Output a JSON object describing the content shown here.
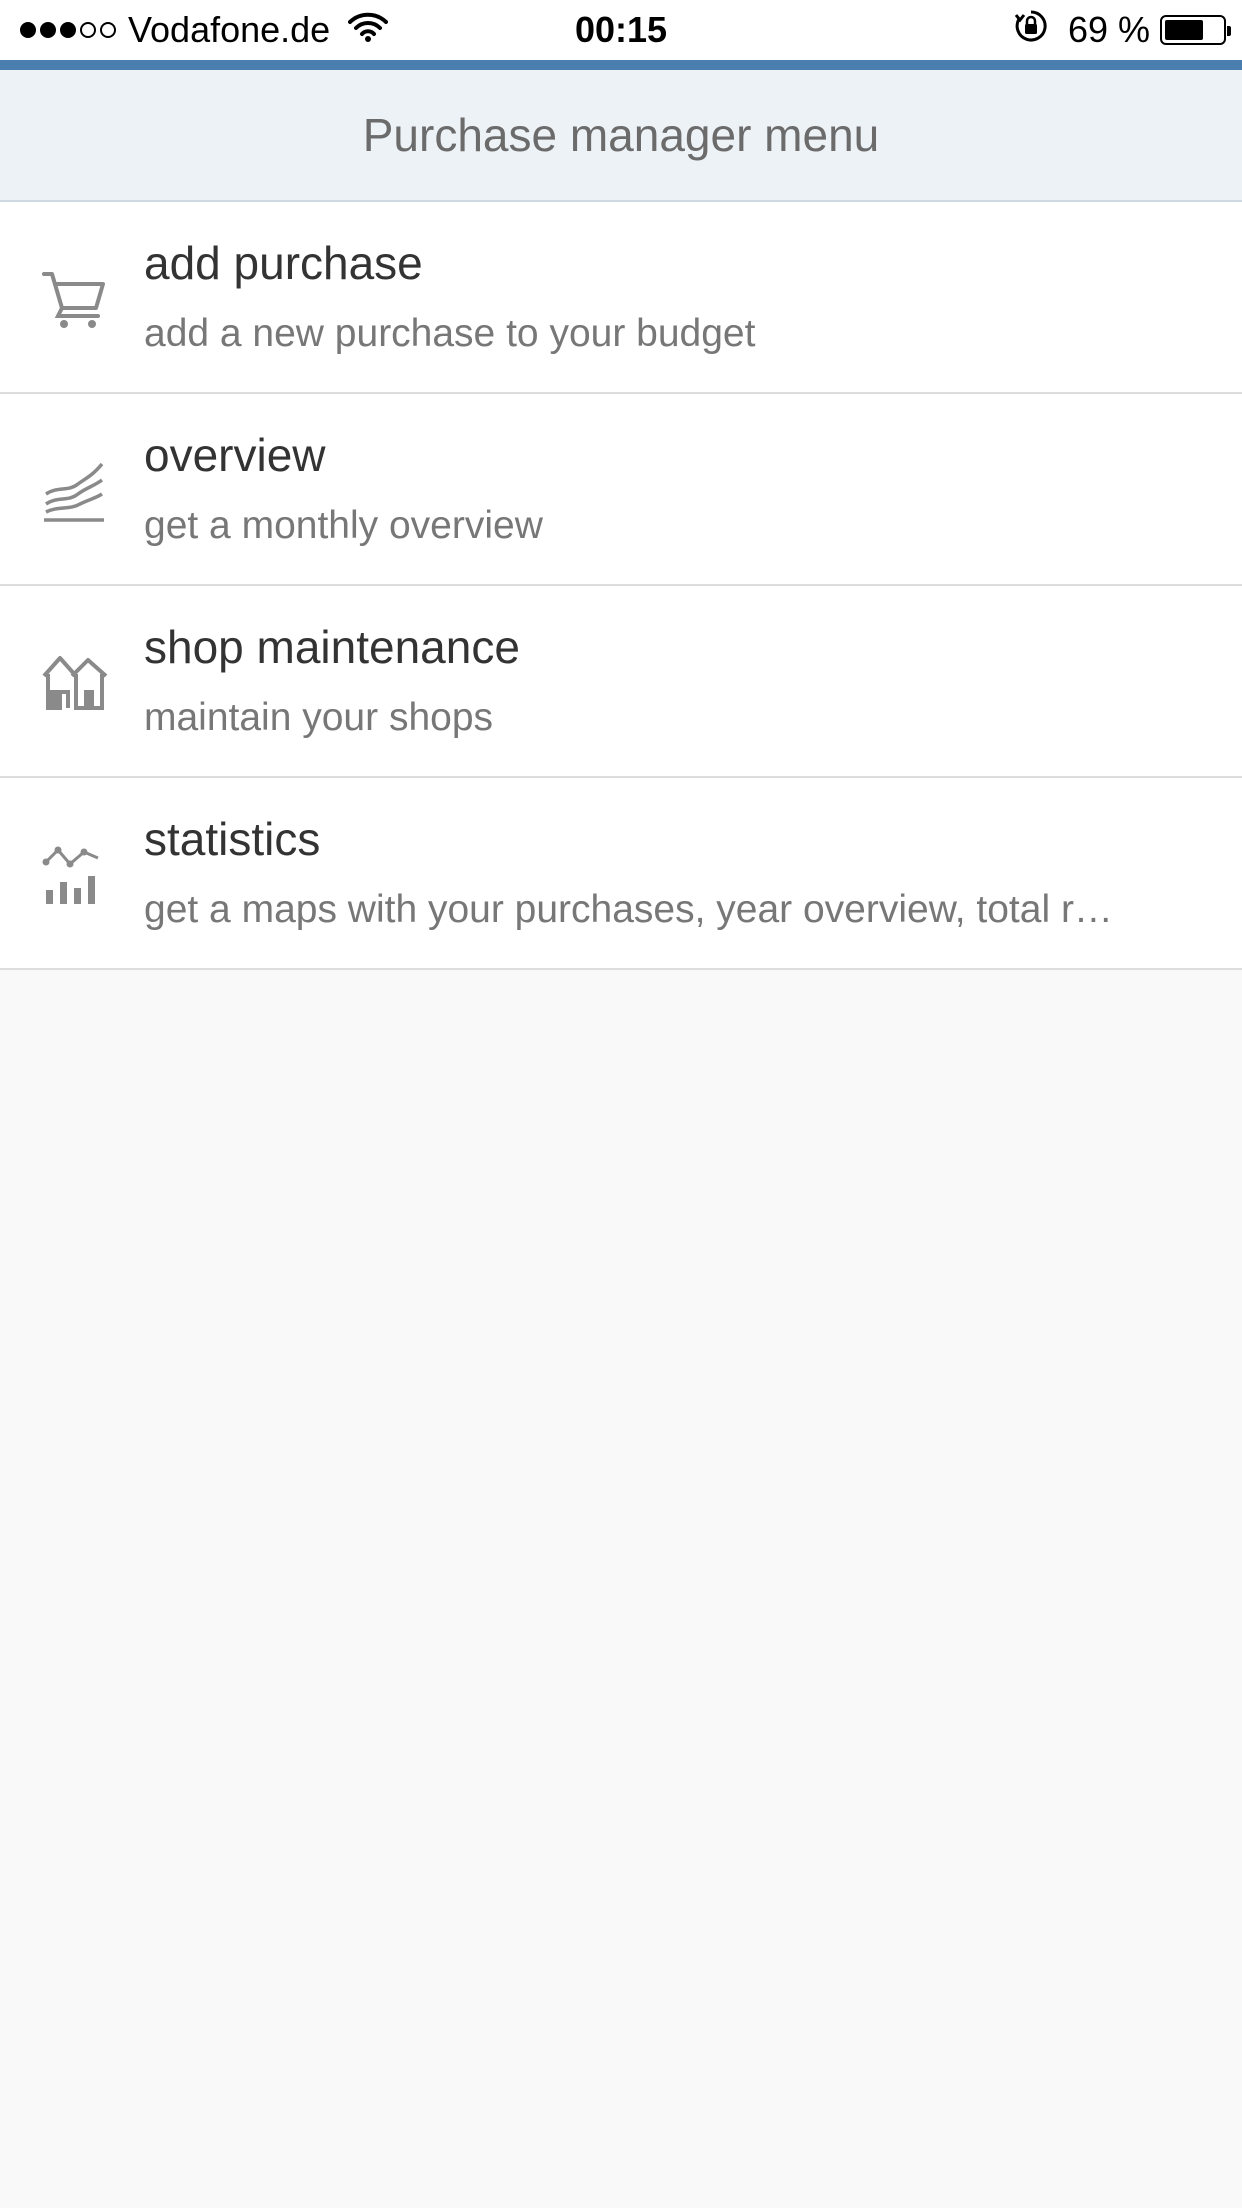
{
  "status_bar": {
    "carrier": "Vodafone.de",
    "signal_bars_filled": 3,
    "signal_bars_total": 5,
    "time": "00:15",
    "battery_percent_label": "69 %",
    "battery_level": 0.69
  },
  "header": {
    "title": "Purchase manager menu"
  },
  "menu": {
    "items": [
      {
        "icon": "shopping-cart-icon",
        "title": "add purchase",
        "description": "add a new purchase to your budget"
      },
      {
        "icon": "area-chart-icon",
        "title": "overview",
        "description": "get a monthly overview"
      },
      {
        "icon": "houses-icon",
        "title": "shop maintenance",
        "description": "maintain your shops"
      },
      {
        "icon": "bar-line-chart-icon",
        "title": "statistics",
        "description": "get a maps with your purchases, year overview, total r…"
      }
    ]
  },
  "colors": {
    "accent": "#4a7eae",
    "header_bg": "#edf2f7",
    "icon": "#8a8a8a"
  }
}
